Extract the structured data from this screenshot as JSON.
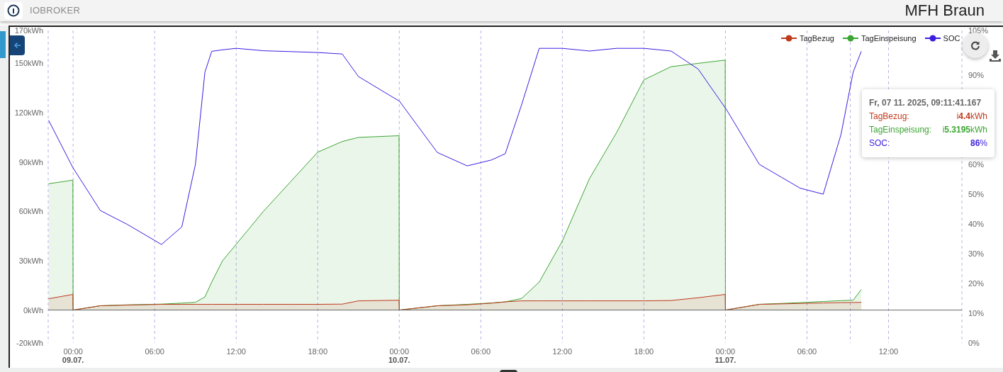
{
  "header": {
    "brand": "IOBROKER",
    "title": "MFH Braun"
  },
  "chart": {
    "day_labels": [
      "09.07.",
      "10.07.",
      "11.07."
    ],
    "tooltip": {
      "time": "Fr, 07 11. 2025, 09:11:41.167",
      "rows": [
        {
          "label": "TagBezug:",
          "value": "i**4.4**kWh",
          "color": "#bf3a1c"
        },
        {
          "label": "TagEinspeisung:",
          "value": "i**5.3195**kWh",
          "color": "#3ca533"
        },
        {
          "label": "SOC:",
          "value": "**86**%",
          "color": "#3a1ee0"
        }
      ]
    },
    "chart_data": {
      "type": "area",
      "grid": true,
      "xlim": [
        "2025-07-08T22:10",
        "2025-07-11T17:24"
      ],
      "ylim": [
        -20,
        170
      ],
      "y2lim": [
        0,
        105
      ],
      "xticks": [
        {
          "value": "2025-07-09T00:00",
          "label": "00:00"
        },
        {
          "value": "2025-07-09T06:00",
          "label": "06:00"
        },
        {
          "value": "2025-07-09T12:00",
          "label": "12:00"
        },
        {
          "value": "2025-07-09T18:00",
          "label": "18:00"
        },
        {
          "value": "2025-07-10T00:00",
          "label": "00:00"
        },
        {
          "value": "2025-07-10T06:00",
          "label": "06:00"
        },
        {
          "value": "2025-07-10T12:00",
          "label": "12:00"
        },
        {
          "value": "2025-07-10T18:00",
          "label": "18:00"
        },
        {
          "value": "2025-07-11T00:00",
          "label": "00:00"
        },
        {
          "value": "2025-07-11T06:00",
          "label": "06:00"
        },
        {
          "value": "2025-07-11T12:00",
          "label": "12:00"
        }
      ],
      "yticks": [
        {
          "value": -20,
          "label": "-20kWh"
        },
        {
          "value": 0,
          "label": "0kWh"
        },
        {
          "value": 30,
          "label": "30kWh"
        },
        {
          "value": 60,
          "label": "60kWh"
        },
        {
          "value": 90,
          "label": "90kWh"
        },
        {
          "value": 120,
          "label": "120kWh"
        },
        {
          "value": 150,
          "label": "150kWh"
        },
        {
          "value": 170,
          "label": "170kWh"
        }
      ],
      "y2ticks": [
        {
          "value": 0,
          "label": "0%"
        },
        {
          "value": 10,
          "label": "10%"
        },
        {
          "value": 20,
          "label": "20%"
        },
        {
          "value": 30,
          "label": "30%"
        },
        {
          "value": 40,
          "label": "40%"
        },
        {
          "value": 50,
          "label": "50%"
        },
        {
          "value": 60,
          "label": "60%"
        },
        {
          "value": 90,
          "label": "90%"
        },
        {
          "value": 105,
          "label": "105%"
        }
      ],
      "x": [
        "2025-07-08T22:12",
        "2025-07-08T23:59",
        "2025-07-09T00:00",
        "2025-07-09T02:00",
        "2025-07-09T04:00",
        "2025-07-09T06:30",
        "2025-07-09T08:00",
        "2025-07-09T09:00",
        "2025-07-09T09:42",
        "2025-07-09T10:12",
        "2025-07-09T11:00",
        "2025-07-09T12:00",
        "2025-07-09T14:00",
        "2025-07-09T16:00",
        "2025-07-09T18:00",
        "2025-07-09T19:48",
        "2025-07-09T21:00",
        "2025-07-09T23:59",
        "2025-07-10T00:00",
        "2025-07-10T02:48",
        "2025-07-10T05:00",
        "2025-07-10T06:48",
        "2025-07-10T07:48",
        "2025-07-10T09:00",
        "2025-07-10T10:18",
        "2025-07-10T12:00",
        "2025-07-10T14:00",
        "2025-07-10T16:00",
        "2025-07-10T18:00",
        "2025-07-10T20:00",
        "2025-07-10T22:00",
        "2025-07-10T23:59",
        "2025-07-11T00:00",
        "2025-07-11T02:30",
        "2025-07-11T05:30",
        "2025-07-11T07:12",
        "2025-07-11T08:30",
        "2025-07-11T09:24",
        "2025-07-11T10:00"
      ],
      "series": [
        {
          "name": "TagBezug",
          "color": "#bf3a1c",
          "values": [
            6.9,
            9.5,
            0,
            2.6,
            3.0,
            3.5,
            3.5,
            3.5,
            3.5,
            3.5,
            3.5,
            3.5,
            3.5,
            3.5,
            3.5,
            3.6,
            5.6,
            6,
            0,
            2.6,
            3.2,
            4.2,
            5,
            5.6,
            5.6,
            5.6,
            5.6,
            5.6,
            5.6,
            5.8,
            7.5,
            9.5,
            0,
            3.5,
            4,
            4.3,
            4.5,
            4.6,
            4.7
          ]
        },
        {
          "name": "TagEinspeisung",
          "color": "#3ca533",
          "values": [
            76.8,
            79,
            0,
            2.6,
            3.2,
            3.6,
            4.2,
            4.7,
            8,
            17,
            30,
            40,
            60,
            78,
            96,
            102.5,
            105,
            106,
            0,
            2.6,
            3.5,
            4.3,
            5,
            7,
            17,
            42,
            80,
            108,
            140,
            148,
            150,
            152,
            0,
            3.5,
            4.5,
            5.2,
            5.7,
            6,
            12.5
          ]
        },
        {
          "name": "SOC",
          "color": "#3a1ee0",
          "type": "line",
          "axis": "y2",
          "values": [
            74.8,
            58.9,
            58.8,
            44.5,
            39.8,
            33.1,
            39,
            60,
            91,
            98,
            98.5,
            99,
            98.2,
            97.9,
            97.6,
            97.1,
            89.5,
            81.3,
            81.3,
            64,
            59.5,
            61.5,
            63.6,
            80,
            99,
            99,
            98.1,
            99,
            99,
            98.1,
            92,
            79,
            79,
            60,
            52,
            50,
            70,
            91,
            98
          ]
        }
      ]
    }
  }
}
